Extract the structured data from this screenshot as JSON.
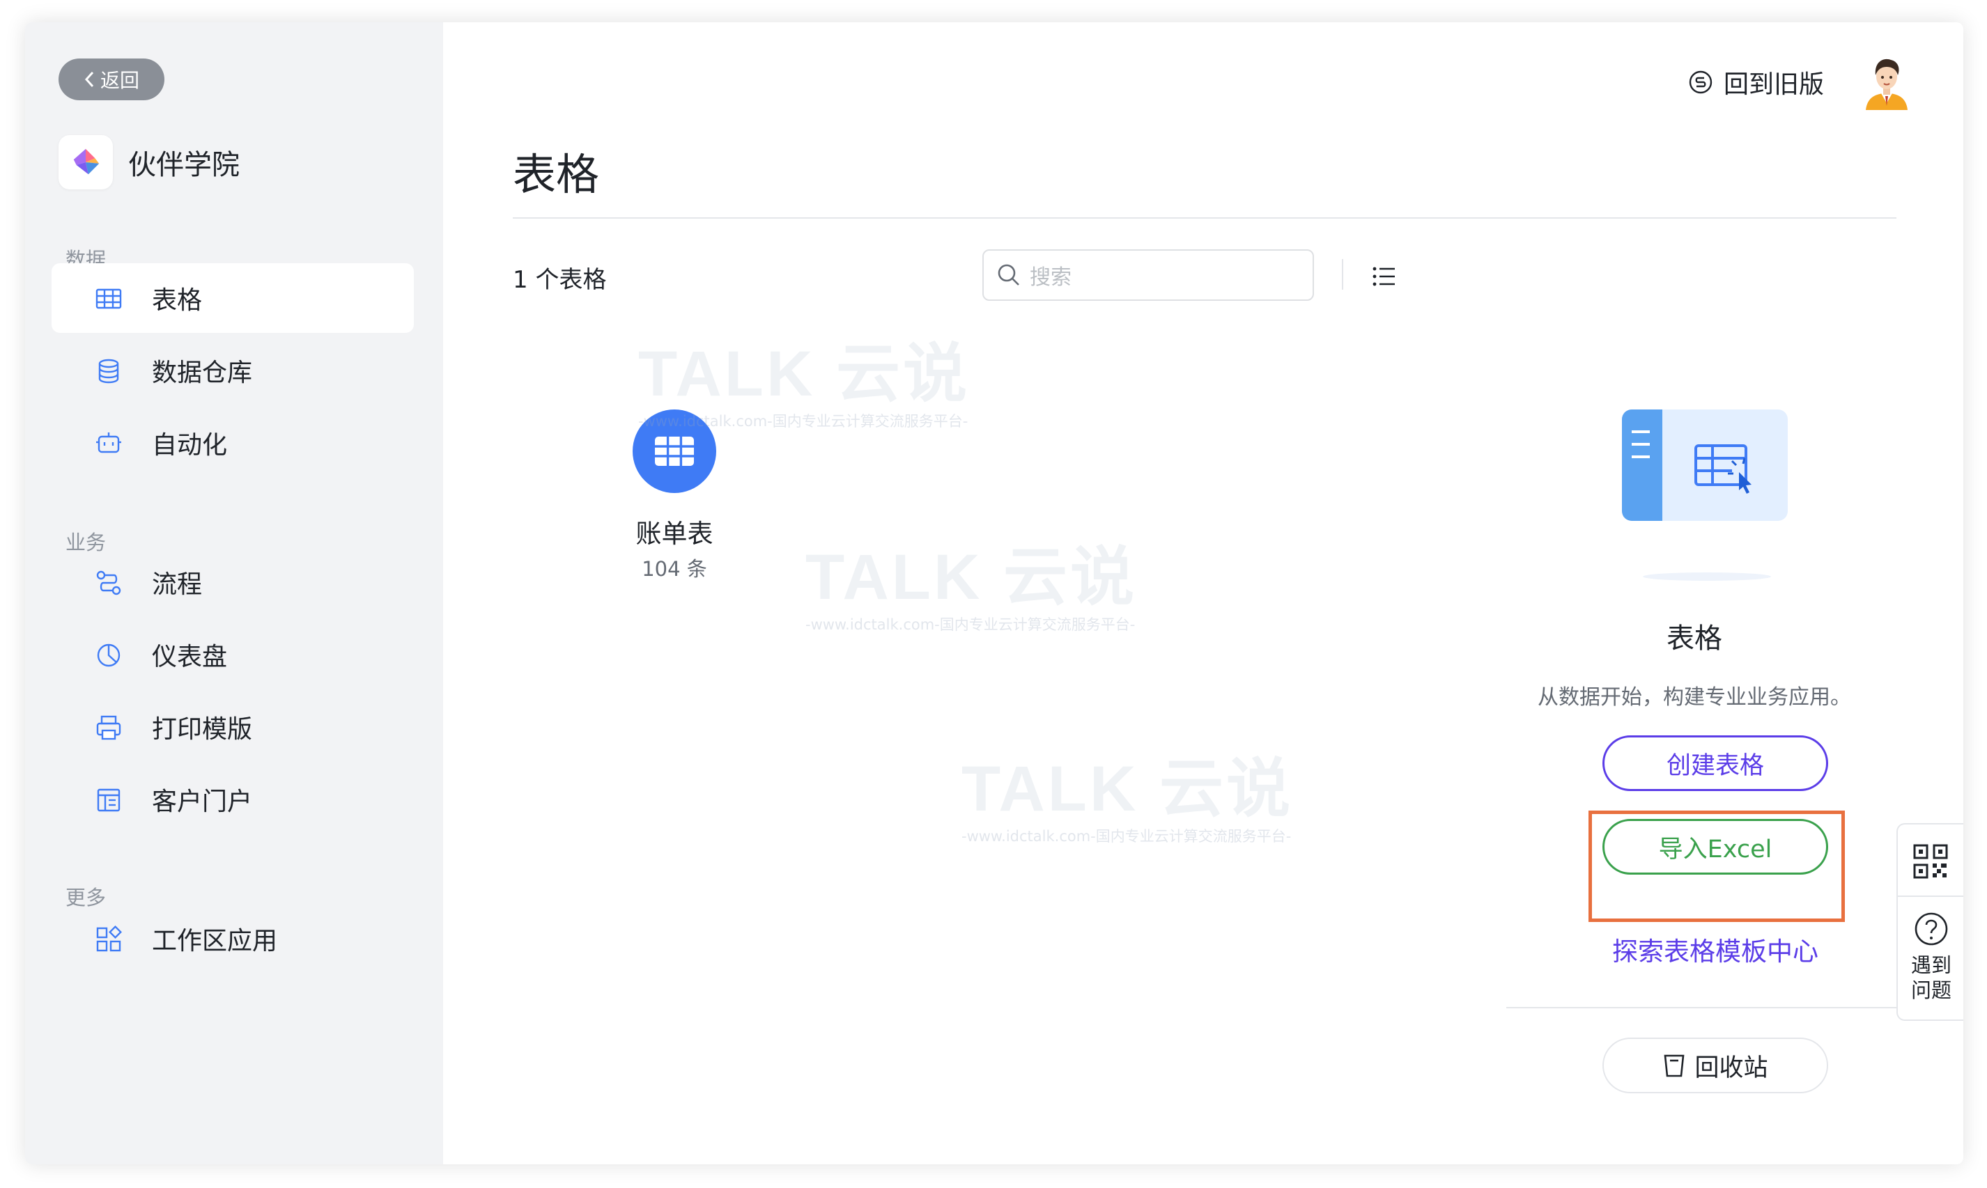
{
  "sidebar": {
    "back_label": "返回",
    "app_name": "伙伴学院",
    "sections": [
      {
        "label": "数据",
        "items": [
          {
            "label": "表格",
            "icon": "table-icon",
            "active": true
          },
          {
            "label": "数据仓库",
            "icon": "database-icon"
          },
          {
            "label": "自动化",
            "icon": "robot-icon"
          }
        ]
      },
      {
        "label": "业务",
        "items": [
          {
            "label": "流程",
            "icon": "workflow-icon"
          },
          {
            "label": "仪表盘",
            "icon": "dashboard-icon"
          },
          {
            "label": "打印模版",
            "icon": "printer-icon"
          },
          {
            "label": "客户门户",
            "icon": "portal-icon"
          }
        ]
      },
      {
        "label": "更多",
        "items": [
          {
            "label": "工作区应用",
            "icon": "apps-icon"
          }
        ]
      }
    ]
  },
  "header": {
    "old_version_label": "回到旧版",
    "page_title": "表格"
  },
  "toolbar": {
    "count_text": "1 个表格",
    "search_placeholder": "搜索"
  },
  "tables": [
    {
      "name": "账单表",
      "meta": "104 条"
    }
  ],
  "panel": {
    "title": "表格",
    "description": "从数据开始，构建专业业务应用。",
    "create_label": "创建表格",
    "import_label": "导入Excel",
    "explore_label": "探索表格模板中心",
    "recycle_label": "回收站"
  },
  "float": {
    "help_label_1": "遇到",
    "help_label_2": "问题"
  },
  "watermark": {
    "brand": "TALK 云说",
    "url": "-www.idctalk.com-国内专业云计算交流服务平台-"
  },
  "colors": {
    "accent": "#3f7bf5",
    "purple": "#5b3de8",
    "green": "#3aa14c",
    "highlight": "#e8703f",
    "sidebar_bg": "#f2f3f5"
  }
}
